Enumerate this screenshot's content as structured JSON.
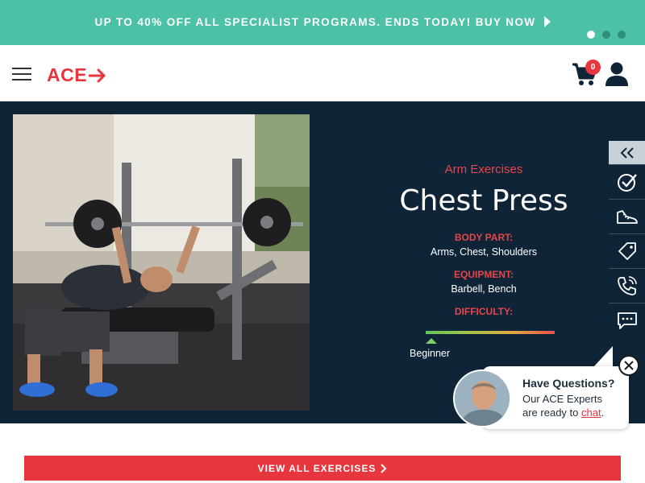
{
  "promo": {
    "text": "UP TO 40% OFF ALL SPECIALIST PROGRAMS. ENDS TODAY! BUY NOW",
    "arrow_icon": "caret-right-icon",
    "slides_total": 3,
    "slide_active": 1
  },
  "header": {
    "logo_text": "ACE",
    "cart_count": "0"
  },
  "exercise": {
    "category": "Arm Exercises",
    "title": "Chest Press",
    "body_part_label": "BODY PART:",
    "body_part_value": "Arms, Chest, Shoulders",
    "equipment_label": "EQUIPMENT:",
    "equipment_value": "Barbell, Bench",
    "difficulty_label": "DIFFICULTY:",
    "difficulty_value": "Beginner",
    "difficulty_level": 0.0
  },
  "sidebar": {
    "items": [
      "double-chevron-left-icon",
      "check-circle-icon",
      "sneaker-icon",
      "price-tag-icon",
      "phone-icon",
      "chat-icon"
    ]
  },
  "chat": {
    "title": "Have Questions?",
    "line1": "Our ACE Experts",
    "line2_prefix": "are ready to ",
    "link": "chat",
    "line2_suffix": "."
  },
  "view_all": {
    "label": "VIEW ALL EXERCISES"
  },
  "colors": {
    "promo_bg": "#4cc1a6",
    "brand_red": "#e7363d",
    "hero_bg": "#0f2537"
  }
}
